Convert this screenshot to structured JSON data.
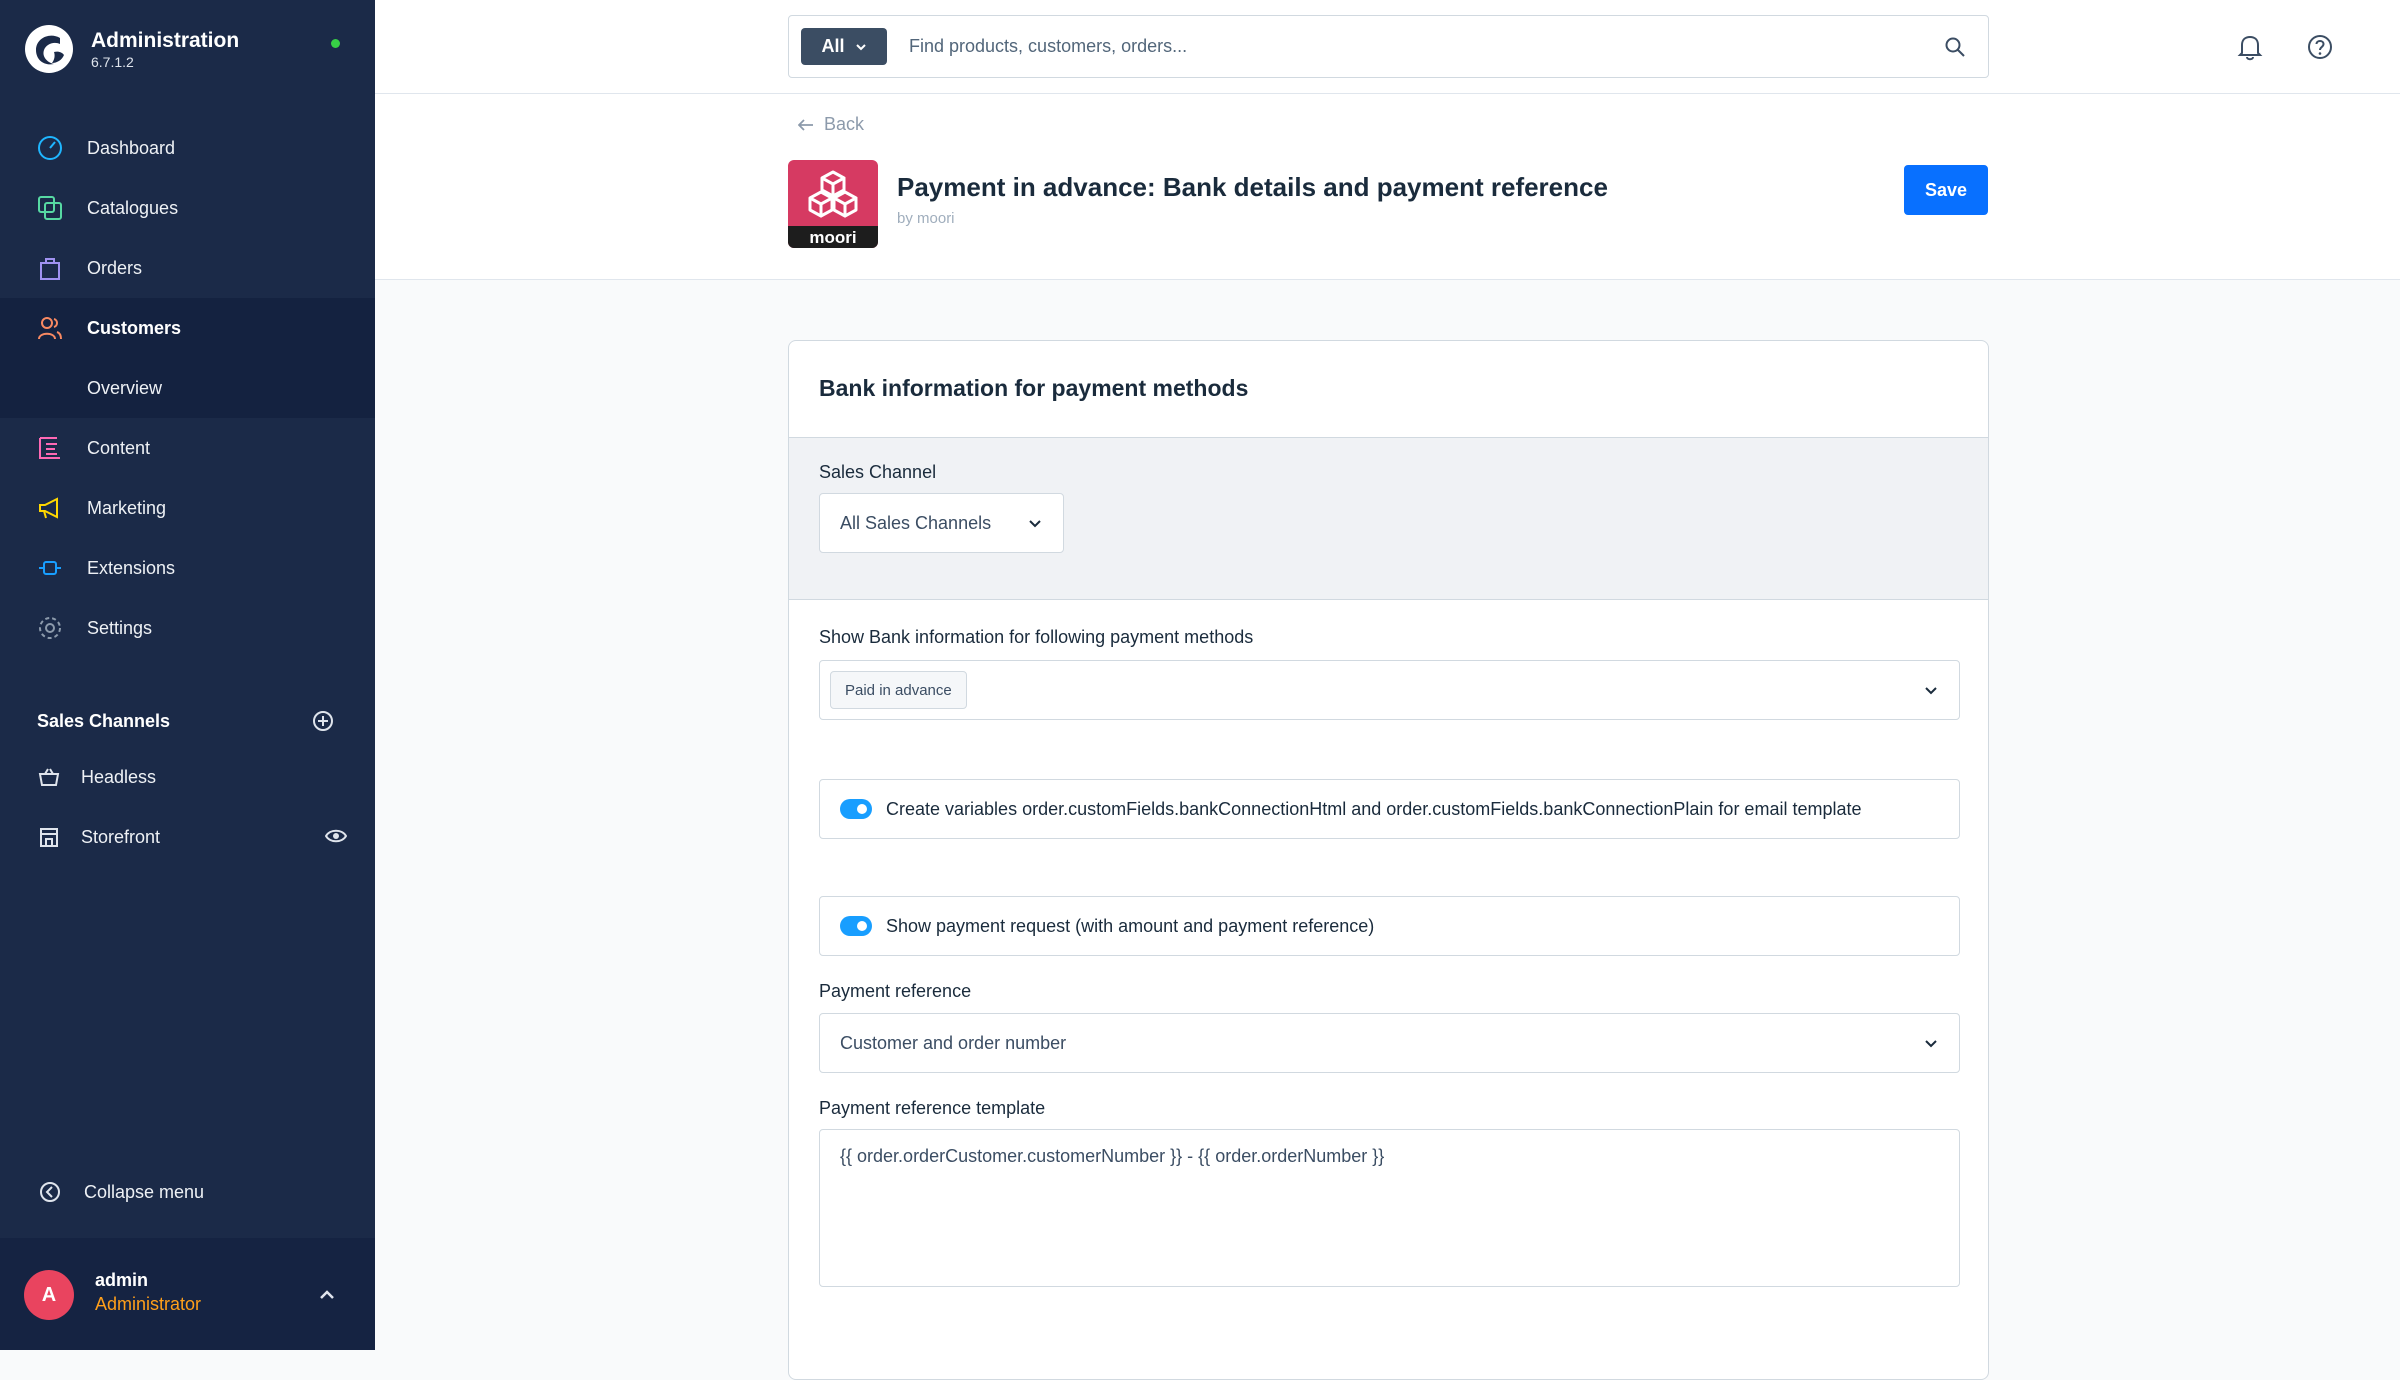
{
  "brand": {
    "title": "Administration",
    "version": "6.7.1.2",
    "status_color": "#37d046"
  },
  "nav": {
    "items": [
      {
        "label": "Dashboard",
        "icon": "dashboard-icon"
      },
      {
        "label": "Catalogues",
        "icon": "catalogue-icon"
      },
      {
        "label": "Orders",
        "icon": "orders-icon"
      },
      {
        "label": "Customers",
        "icon": "customers-icon",
        "active": true
      },
      {
        "label": "Content",
        "icon": "content-icon"
      },
      {
        "label": "Marketing",
        "icon": "marketing-icon"
      },
      {
        "label": "Extensions",
        "icon": "extensions-icon"
      },
      {
        "label": "Settings",
        "icon": "settings-icon"
      }
    ],
    "customers_sub": "Overview"
  },
  "sales_channels": {
    "title": "Sales Channels",
    "items": [
      {
        "label": "Headless",
        "icon": "basket-icon"
      },
      {
        "label": "Storefront",
        "icon": "storefront-icon"
      }
    ]
  },
  "collapse_label": "Collapse menu",
  "user": {
    "initial": "A",
    "name": "admin",
    "role": "Administrator"
  },
  "search": {
    "type_label": "All",
    "placeholder": "Find products, customers, orders..."
  },
  "header": {
    "back_label": "Back",
    "title": "Payment in advance: Bank details and payment reference",
    "subtitle": "by moori",
    "logo_text": "moori",
    "save_label": "Save"
  },
  "card": {
    "title": "Bank information for payment methods",
    "sales_channel_label": "Sales Channel",
    "sales_channel_value": "All Sales Channels",
    "payment_methods_label": "Show Bank information for following payment methods",
    "payment_methods_tag": "Paid in advance",
    "toggle_variables_label": "Create variables order.customFields.bankConnectionHtml and order.customFields.bankConnectionPlain for email template",
    "toggle_payment_request_label": "Show payment request (with amount and payment reference)",
    "payment_reference_label": "Payment reference",
    "payment_reference_value": "Customer and order number",
    "template_label": "Payment reference template",
    "template_value": "{{ order.orderCustomer.customerNumber }} - {{ order.orderNumber }}"
  },
  "colors": {
    "sidebar": "#1b2a48",
    "accent": "#0870ff",
    "toggle": "#189eff",
    "role": "#ff9f1a",
    "avatar": "#e9445f"
  }
}
